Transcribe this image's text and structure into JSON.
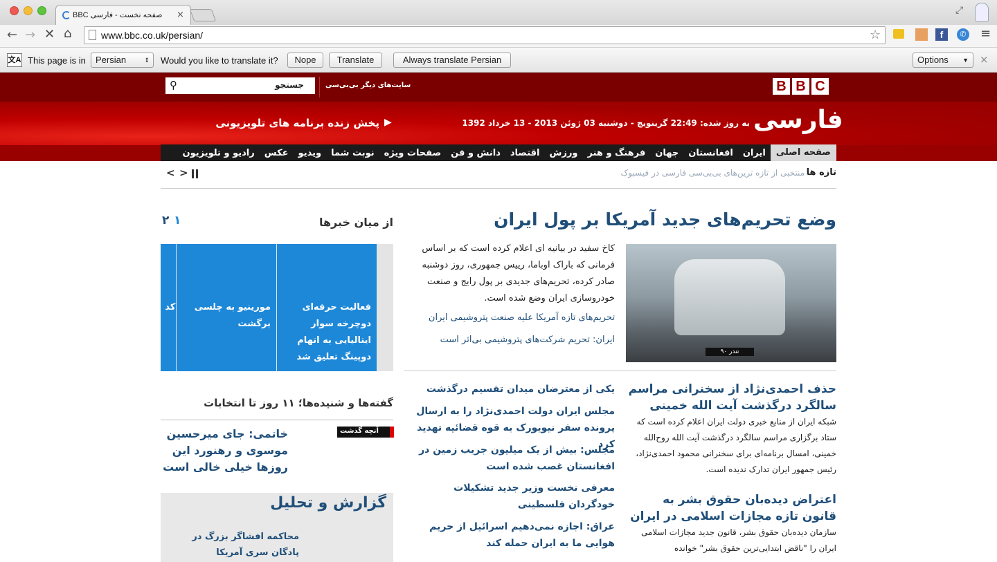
{
  "browser": {
    "tab_title": "صفحه نخست - فارسی BBC",
    "url": "www.bbc.co.uk/persian/"
  },
  "infobar": {
    "prefix": "This page is in",
    "language": "Persian",
    "question": "Would you like to translate it?",
    "nope": "Nope",
    "translate": "Translate",
    "always": "Always translate Persian",
    "options": "Options"
  },
  "bbc": {
    "logo": [
      "B",
      "B",
      "C"
    ],
    "search_placeholder": "جستجو",
    "other_sites": "سایت‌های دیگر بی‌بی‌سی",
    "brand": "فارسی",
    "updated": "به روز شده:  22:49 گرینویچ - دوشنبه 03 ژوئن 2013 - 13 خرداد 1392",
    "live_tv": "پخش زنده برنامه های تلویزیونی"
  },
  "nav": [
    "صفحه اصلی",
    "ایران",
    "افغانستان",
    "جهان",
    "فرهنگ و هنر",
    "ورزش",
    "اقتصاد",
    "دانش و فن",
    "صفحات ویژه",
    "نوبت شما",
    "ویدیو",
    "عکس",
    "رادیو و تلویزیون"
  ],
  "ticker": {
    "label": "تازه ها",
    "text": "منتخبی از تازه ترین‌های بی‌بی‌سی فارسی در فیسبوک"
  },
  "lead": {
    "headline": "وضع تحریم‌های جدید آمریکا بر پول ایران",
    "summary": "کاخ سفید در بیانیه ای اعلام کرده است که بر اساس فرمانی که باراک اوباما، رییس جمهوری، روز دوشنبه صادر کرده، تحریم‌های جدیدی بر پول رایج و صنعت خودروسازی ایران وضع شده است.",
    "links": [
      "تحریم‌های تازه آمریکا علیه صنعت پتروشیمی ایران",
      "ایران: تحریم شرکت‌های پتروشیمی بی‌اثر است"
    ],
    "car_plate": "تندر ۹۰"
  },
  "story2": {
    "headline": "حذف احمدی‌نژاد از سخنرانی مراسم سالگرد درگذشت آیت الله خمینی",
    "summary": "شبکه ایران از منابع خبری دولت ایران اعلام کرده است که ستاد برگزاری مراسم سالگرد درگذشت آیت الله روح‌الله خمینی، امسال برنامه‌ای برای سخنرانی محمود احمدی‌نژاد، رئیس جمهور ایران تدارک ندیده است."
  },
  "story3": {
    "headline": "اعتراض دیده‌بان حقوق بشر به قانون تازه مجازات اسلامی در ایران",
    "summary": "سازمان دیده‌بان حقوق بشر، قانون جدید مجازات اسلامی ایران را \"ناقض ابتدایی‌ترین حقوق بشر\" خوانده"
  },
  "mid_links": [
    "یکی از معترضان میدان تقسیم درگذشت",
    "مجلس ایران دولت احمدی‌نژاد را به ارسال پرونده سفر نیویورک به قوه قضائیه تهدید کرد",
    "مجلس: بیش از یک میلیون جریب زمین در افغانستان غصب شده است",
    "معرفی نخست وزیر جدید تشکیلات خودگردان فلسطینی",
    "عراق: اجازه نمی‌دهیم اسرائیل از حریم هوایی ما به ایران حمله کند"
  ],
  "sidebar": {
    "title": "از میان خبرها",
    "pager": [
      "۱",
      "۲"
    ],
    "cards": [
      "فعالیت حرفه‌ای دوچرخه سوار ایتالیایی به اتهام دوپینگ تعلیق شد",
      "مورینیو به چلسی برگشت",
      "نشان کد نام"
    ],
    "quotes_title": "گفته‌ها و شنیده‌ها؛ ۱۱ روز تا انتخابات",
    "quotes_badge": "آنچه گذشت",
    "quote": "خاتمی: جای میرحسین موسوی و رهنورد این روزها خیلی خالی است",
    "report_title": "گزارش و تحلیل",
    "report_item": "محاکمه افشاگر بزرگ در پادگان سری آمریکا"
  },
  "colors": {
    "bbc_red": "#990000",
    "link_blue": "#1f4e79",
    "card_blue": "#1e88d8"
  }
}
